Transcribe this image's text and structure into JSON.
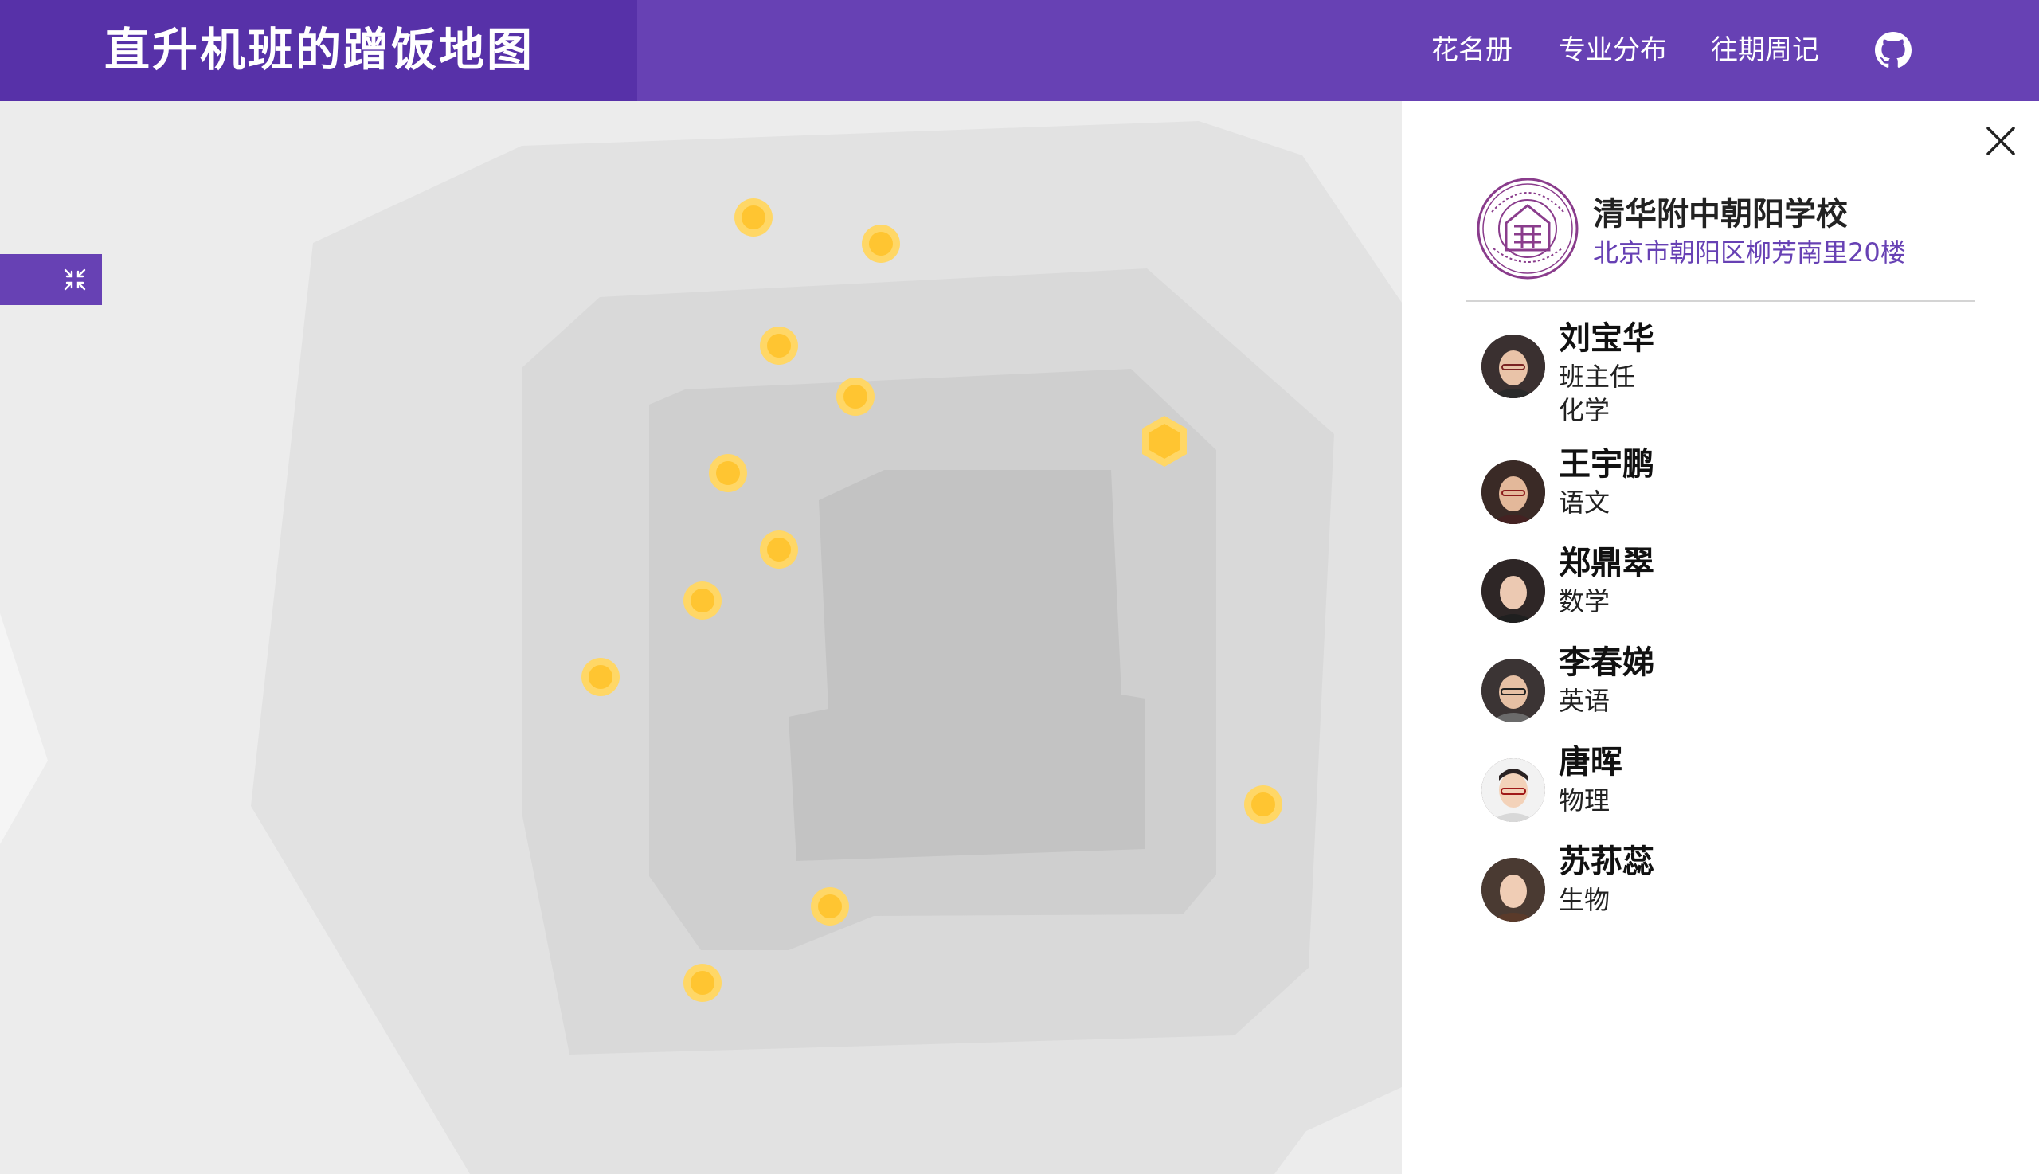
{
  "header": {
    "title": "直升机班的蹭饭地图",
    "nav": [
      "花名册",
      "专业分布",
      "往期周记"
    ],
    "github_icon": "github-icon",
    "background": "#6741b4",
    "brand_background": "#5731a8"
  },
  "map": {
    "marker_color": "#ffc531",
    "marker_halo": "#ffd766",
    "selected_marker": "hexagon",
    "collapse_icon": "collapse-icon"
  },
  "panel": {
    "close_icon": "close-icon",
    "school": {
      "name": "清华附中朝阳学校",
      "address": "北京市朝阳区柳芳南里20楼",
      "logo_icon": "school-seal-logo"
    },
    "teachers": [
      {
        "name": "刘宝华",
        "roles": [
          "班主任",
          "化学"
        ]
      },
      {
        "name": "王宇鹏",
        "roles": [
          "语文"
        ]
      },
      {
        "name": "郑鼎翠",
        "roles": [
          "数学"
        ]
      },
      {
        "name": "李春娣",
        "roles": [
          "英语"
        ]
      },
      {
        "name": "唐晖",
        "roles": [
          "物理"
        ]
      },
      {
        "name": "苏荪蕊",
        "roles": [
          "生物"
        ]
      }
    ]
  }
}
